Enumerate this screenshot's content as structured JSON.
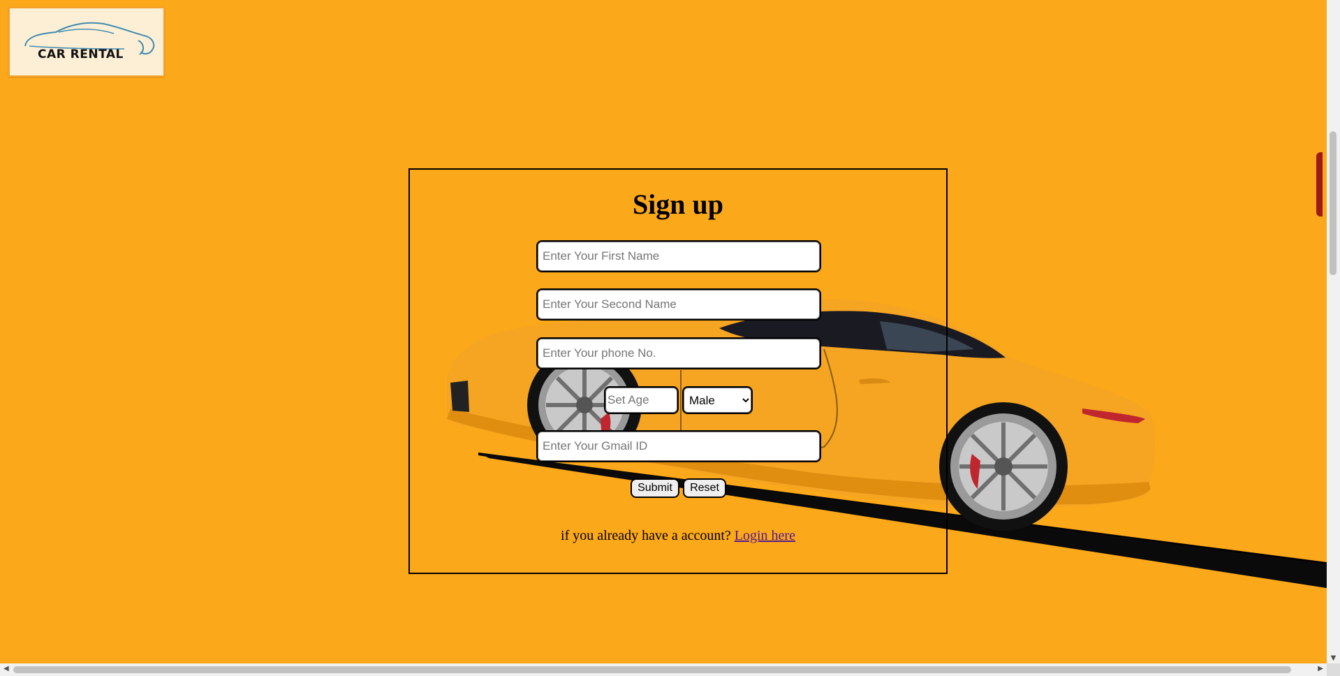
{
  "colors": {
    "background": "#FCA81B",
    "logo_background": "#FDEFD6",
    "car_body": "#F5A521",
    "link": "#551A8B",
    "scrollbar_accent": "#9E1A1A"
  },
  "logo": {
    "text": "CAR RENTAL",
    "icon": "car-outline-logo"
  },
  "form": {
    "title": "Sign up",
    "first_name_placeholder": "Enter Your First Name",
    "second_name_placeholder": "Enter Your Second Name",
    "phone_placeholder": "Enter Your phone No.",
    "age_placeholder": "Set Age",
    "gender_selected": "Male",
    "gmail_placeholder": "Enter Your Gmail ID",
    "submit_label": "Submit",
    "reset_label": "Reset",
    "login_prompt": "if you already have a account?",
    "login_link": "Login here"
  },
  "scrollbars": {
    "up_arrow": "▲",
    "down_arrow": "▼",
    "left_arrow": "◀",
    "right_arrow": "▶"
  }
}
